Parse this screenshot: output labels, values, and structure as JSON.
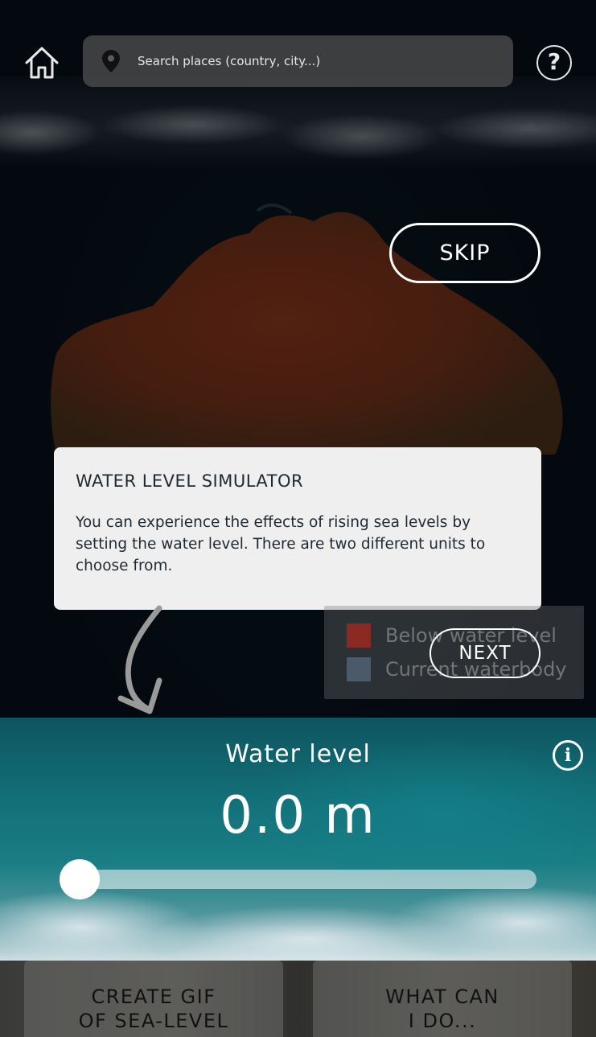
{
  "header": {
    "search_placeholder": "Search places (country, city...)",
    "help_label": "?"
  },
  "tour": {
    "skip_label": "SKIP",
    "next_label": "NEXT",
    "tooltip": {
      "title": "WATER LEVEL SIMULATOR",
      "body": "You can experience the effects of rising sea levels by setting the water level. There are two different units to choose from."
    }
  },
  "legend": {
    "items": [
      {
        "label": "Below water level",
        "color": "#8a2a22"
      },
      {
        "label": "Current waterbody",
        "color": "#4a5a6a"
      }
    ]
  },
  "water_panel": {
    "title": "Water level",
    "value": "0.0 m",
    "info_label": "i",
    "slider_level": 0
  },
  "bottom_buttons": {
    "gif_line1": "CREATE GIF",
    "gif_line2": "OF SEA-LEVEL",
    "what_line1": "WHAT CAN",
    "what_line2": "I DO..."
  }
}
